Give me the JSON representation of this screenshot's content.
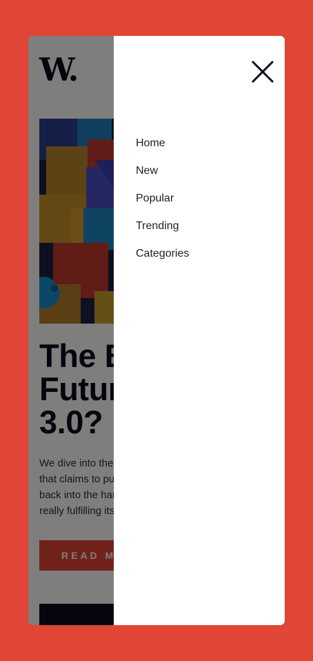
{
  "site": {
    "logo": "W."
  },
  "article": {
    "headline_line1": "The Bright",
    "headline_line2": "Future of Web",
    "headline_line3": "3.0?",
    "excerpt": "We dive into the next evolution of the web that claims to put the power of the platforms back into the hands of the people. But is it really fulfilling its promise?",
    "cta_label": "READ MORE"
  },
  "menu": {
    "close_icon": "close-icon",
    "items": [
      {
        "label": "Home"
      },
      {
        "label": "New"
      },
      {
        "label": "Popular"
      },
      {
        "label": "Trending"
      },
      {
        "label": "Categories"
      }
    ]
  },
  "colors": {
    "page_background": "#e04535",
    "accent": "#e04535",
    "text_dark": "#0a0d1a",
    "drawer_background": "#ffffff"
  }
}
